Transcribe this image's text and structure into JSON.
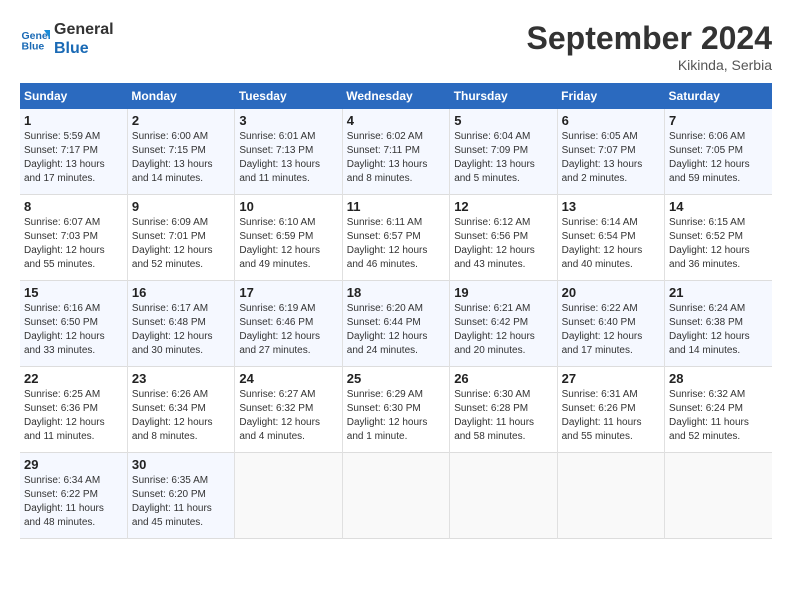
{
  "header": {
    "logo_line1": "General",
    "logo_line2": "Blue",
    "month_title": "September 2024",
    "subtitle": "Kikinda, Serbia"
  },
  "days_of_week": [
    "Sunday",
    "Monday",
    "Tuesday",
    "Wednesday",
    "Thursday",
    "Friday",
    "Saturday"
  ],
  "weeks": [
    [
      {
        "day": "1",
        "sunrise": "5:59 AM",
        "sunset": "7:17 PM",
        "daylight": "13 hours and 17 minutes."
      },
      {
        "day": "2",
        "sunrise": "6:00 AM",
        "sunset": "7:15 PM",
        "daylight": "13 hours and 14 minutes."
      },
      {
        "day": "3",
        "sunrise": "6:01 AM",
        "sunset": "7:13 PM",
        "daylight": "13 hours and 11 minutes."
      },
      {
        "day": "4",
        "sunrise": "6:02 AM",
        "sunset": "7:11 PM",
        "daylight": "13 hours and 8 minutes."
      },
      {
        "day": "5",
        "sunrise": "6:04 AM",
        "sunset": "7:09 PM",
        "daylight": "13 hours and 5 minutes."
      },
      {
        "day": "6",
        "sunrise": "6:05 AM",
        "sunset": "7:07 PM",
        "daylight": "13 hours and 2 minutes."
      },
      {
        "day": "7",
        "sunrise": "6:06 AM",
        "sunset": "7:05 PM",
        "daylight": "12 hours and 59 minutes."
      }
    ],
    [
      {
        "day": "8",
        "sunrise": "6:07 AM",
        "sunset": "7:03 PM",
        "daylight": "12 hours and 55 minutes."
      },
      {
        "day": "9",
        "sunrise": "6:09 AM",
        "sunset": "7:01 PM",
        "daylight": "12 hours and 52 minutes."
      },
      {
        "day": "10",
        "sunrise": "6:10 AM",
        "sunset": "6:59 PM",
        "daylight": "12 hours and 49 minutes."
      },
      {
        "day": "11",
        "sunrise": "6:11 AM",
        "sunset": "6:57 PM",
        "daylight": "12 hours and 46 minutes."
      },
      {
        "day": "12",
        "sunrise": "6:12 AM",
        "sunset": "6:56 PM",
        "daylight": "12 hours and 43 minutes."
      },
      {
        "day": "13",
        "sunrise": "6:14 AM",
        "sunset": "6:54 PM",
        "daylight": "12 hours and 40 minutes."
      },
      {
        "day": "14",
        "sunrise": "6:15 AM",
        "sunset": "6:52 PM",
        "daylight": "12 hours and 36 minutes."
      }
    ],
    [
      {
        "day": "15",
        "sunrise": "6:16 AM",
        "sunset": "6:50 PM",
        "daylight": "12 hours and 33 minutes."
      },
      {
        "day": "16",
        "sunrise": "6:17 AM",
        "sunset": "6:48 PM",
        "daylight": "12 hours and 30 minutes."
      },
      {
        "day": "17",
        "sunrise": "6:19 AM",
        "sunset": "6:46 PM",
        "daylight": "12 hours and 27 minutes."
      },
      {
        "day": "18",
        "sunrise": "6:20 AM",
        "sunset": "6:44 PM",
        "daylight": "12 hours and 24 minutes."
      },
      {
        "day": "19",
        "sunrise": "6:21 AM",
        "sunset": "6:42 PM",
        "daylight": "12 hours and 20 minutes."
      },
      {
        "day": "20",
        "sunrise": "6:22 AM",
        "sunset": "6:40 PM",
        "daylight": "12 hours and 17 minutes."
      },
      {
        "day": "21",
        "sunrise": "6:24 AM",
        "sunset": "6:38 PM",
        "daylight": "12 hours and 14 minutes."
      }
    ],
    [
      {
        "day": "22",
        "sunrise": "6:25 AM",
        "sunset": "6:36 PM",
        "daylight": "12 hours and 11 minutes."
      },
      {
        "day": "23",
        "sunrise": "6:26 AM",
        "sunset": "6:34 PM",
        "daylight": "12 hours and 8 minutes."
      },
      {
        "day": "24",
        "sunrise": "6:27 AM",
        "sunset": "6:32 PM",
        "daylight": "12 hours and 4 minutes."
      },
      {
        "day": "25",
        "sunrise": "6:29 AM",
        "sunset": "6:30 PM",
        "daylight": "12 hours and 1 minute."
      },
      {
        "day": "26",
        "sunrise": "6:30 AM",
        "sunset": "6:28 PM",
        "daylight": "11 hours and 58 minutes."
      },
      {
        "day": "27",
        "sunrise": "6:31 AM",
        "sunset": "6:26 PM",
        "daylight": "11 hours and 55 minutes."
      },
      {
        "day": "28",
        "sunrise": "6:32 AM",
        "sunset": "6:24 PM",
        "daylight": "11 hours and 52 minutes."
      }
    ],
    [
      {
        "day": "29",
        "sunrise": "6:34 AM",
        "sunset": "6:22 PM",
        "daylight": "11 hours and 48 minutes."
      },
      {
        "day": "30",
        "sunrise": "6:35 AM",
        "sunset": "6:20 PM",
        "daylight": "11 hours and 45 minutes."
      },
      null,
      null,
      null,
      null,
      null
    ]
  ]
}
